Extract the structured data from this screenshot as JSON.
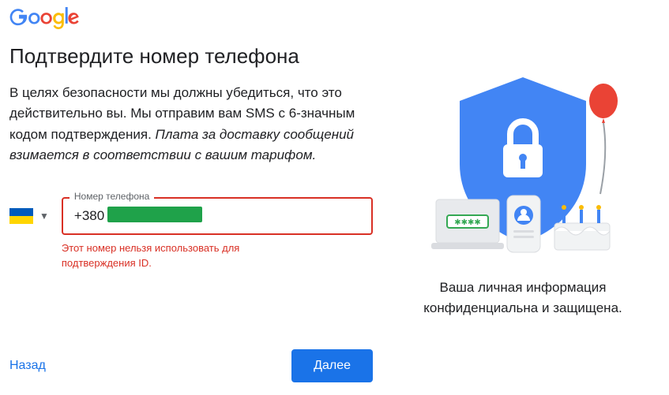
{
  "logo_alt": "Google",
  "heading": "Подтвердите номер телефона",
  "description_plain": "В целях безопасности мы должны убедиться, что это действительно вы. Мы отправим вам SMS с 6-значным кодом подтверждения.",
  "description_italic": "Плата за доставку сообщений взимается в соответствии с вашим тарифом.",
  "country_code": "UA",
  "phone": {
    "label": "Номер телефона",
    "value": "+380",
    "error": "Этот номер нельзя использовать для подтверждения ID."
  },
  "actions": {
    "back": "Назад",
    "next": "Далее"
  },
  "privacy_line1": "Ваша личная информация",
  "privacy_line2": "конфиденциальна и защищена.",
  "colors": {
    "primary": "#1a73e8",
    "error": "#d93025"
  }
}
